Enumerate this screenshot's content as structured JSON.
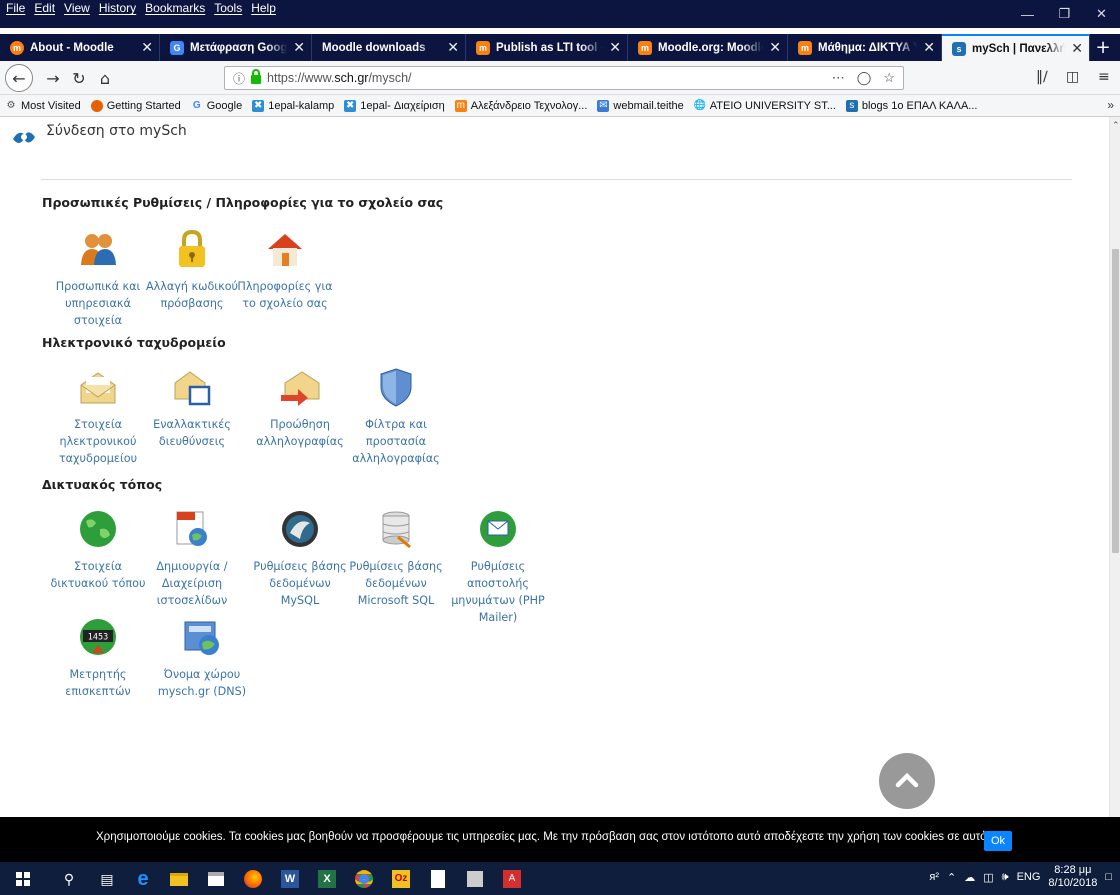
{
  "menubar": {
    "menus": [
      "File",
      "Edit",
      "View",
      "History",
      "Bookmarks",
      "Tools",
      "Help"
    ]
  },
  "tabs": [
    {
      "title": "About - Moodle",
      "fav_color": "#f98012"
    },
    {
      "title": "Μετάφραση Google",
      "fav_color": "#4285f4"
    },
    {
      "title": "Moodle downloads",
      "fav_color": ""
    },
    {
      "title": "Publish as LTI tool - M",
      "fav_color": "#f98012"
    },
    {
      "title": "Moodle.org: Moodle S",
      "fav_color": "#f98012"
    },
    {
      "title": "Μάθημα: ΔΙΚΤΥΑ ΥΠΟ",
      "fav_color": "#f98012"
    },
    {
      "title": "mySch | Πανελλήνιο Σ",
      "fav_color": "#1f6fb2"
    }
  ],
  "address": {
    "url_prefix": "https://www.",
    "url_domain": "sch.gr",
    "url_path": "/mysch/"
  },
  "bookmarks": [
    {
      "label": "Most Visited",
      "color": "#888"
    },
    {
      "label": "Getting Started",
      "color": "#e66000"
    },
    {
      "label": "Google",
      "color": "#4285f4"
    },
    {
      "label": "1epal-kalamp",
      "color": "#2c8fd6"
    },
    {
      "label": "1epal- Διαχείριση",
      "color": "#2c8fd6"
    },
    {
      "label": "Αλεξάνδρειο Τεχνολογ...",
      "color": "#f98012"
    },
    {
      "label": "webmail.teithe",
      "color": "#3a7bd5"
    },
    {
      "label": "ATEIO UNIVERSITY ST...",
      "color": "#444"
    },
    {
      "label": "blogs 1o ΕΠΑΛ ΚΑΛΑ...",
      "color": "#1f6fb2"
    }
  ],
  "page": {
    "login_text": "Σύνδεση στο mySch",
    "sections": [
      {
        "title": "Προσωπικές Ρυθμίσεις / Πληροφορίες για το σχολείο σας",
        "items": [
          {
            "label": "Προσωπικά και υπηρεσιακά στοιχεία",
            "icon": "users-icon"
          },
          {
            "label": "Αλλαγή κωδικού πρόσβασης",
            "icon": "padlock-icon"
          },
          {
            "label": "Πληροφορίες για το σχολείο σας",
            "icon": "house-icon"
          }
        ]
      },
      {
        "title": "Ηλεκτρονικό ταχυδρομείο",
        "items": [
          {
            "label": "Στοιχεία ηλεκτρονικού ταχυδρομείου",
            "icon": "envelope-icon"
          },
          {
            "label": "Εναλλακτικές διευθύνσεις",
            "icon": "envelope-window-icon"
          },
          {
            "label": "Προώθηση αλληλογραφίας",
            "icon": "envelope-forward-icon"
          },
          {
            "label": "Φίλτρα και προστασία αλληλογραφίας",
            "icon": "shield-icon"
          }
        ]
      },
      {
        "title": "Δικτυακός τόπος",
        "items": [
          {
            "label": "Στοιχεία δικτυακού τόπου",
            "icon": "globe-icon"
          },
          {
            "label": "Δημιουργία / Διαχείριση ιστοσελίδων",
            "icon": "html-page-icon"
          },
          {
            "label": "Ρυθμίσεις βάσης δεδομένων MySQL",
            "icon": "mysql-icon"
          },
          {
            "label": "Ρυθμίσεις βάσης δεδομένων Microsoft SQL",
            "icon": "database-icon"
          },
          {
            "label": "Ρυθμίσεις αποστολής μηνυμάτων (PHP Mailer)",
            "icon": "mail-globe-icon"
          },
          {
            "label": "Μετρητής επισκεπτών",
            "icon": "counter-icon"
          },
          {
            "label": "Όνομα χώρου mysch.gr (DNS)",
            "icon": "dns-icon"
          }
        ]
      }
    ],
    "counter_digits": "1453"
  },
  "cookies": {
    "text": "Χρησιμοποιούμε cookies. Τα cookies μας βοηθούν να προσφέρουμε τις υπηρεσίες μας. Με την πρόσβαση σας στον ιστότοπο αυτό αποδέχεστε την χρήση των cookies σε αυτό.",
    "ok_label": "Ok"
  },
  "taskbar": {
    "lang": "ENG",
    "time": "8:28 μμ",
    "date": "8/10/2018"
  }
}
